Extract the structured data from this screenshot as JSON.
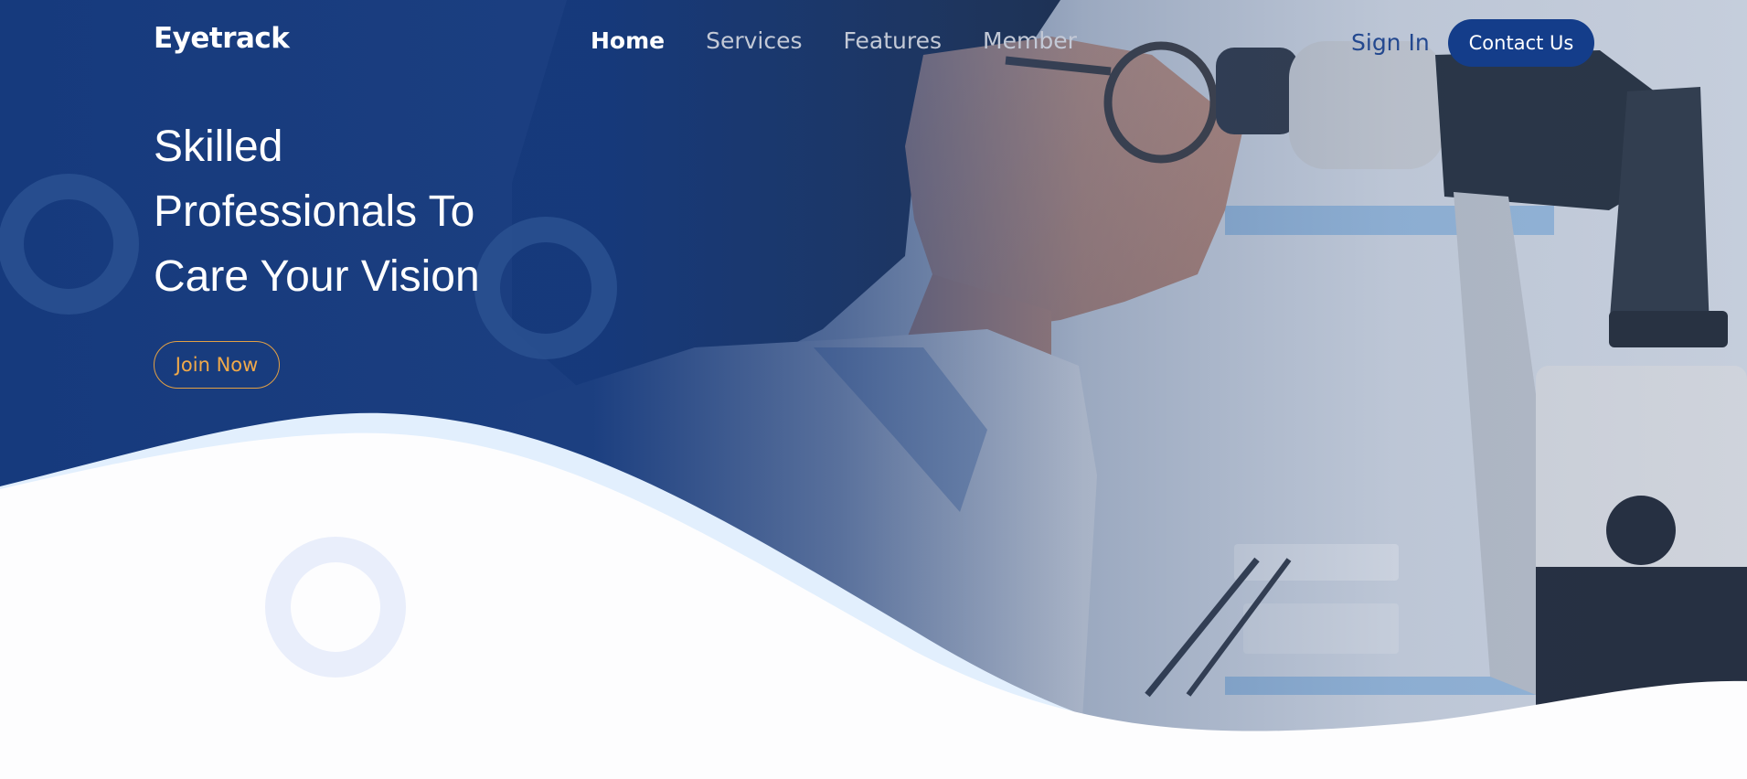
{
  "brand": {
    "name": "Eyetrack"
  },
  "nav": {
    "items": [
      {
        "label": "Home",
        "active": true
      },
      {
        "label": "Services",
        "active": false
      },
      {
        "label": "Features",
        "active": false
      },
      {
        "label": "Member",
        "active": false
      }
    ],
    "sign_in": "Sign In",
    "contact": "Contact Us"
  },
  "hero": {
    "title_lines": [
      "Skilled",
      "Professionals To",
      "Care Your Vision"
    ],
    "cta": "Join Now",
    "photo_subject": "optometrist-at-slit-lamp"
  },
  "colors": {
    "primary": "#143d8a",
    "accent": "#f0a94a",
    "wave_light": "#e2effd",
    "background": "#fdfdfe"
  }
}
